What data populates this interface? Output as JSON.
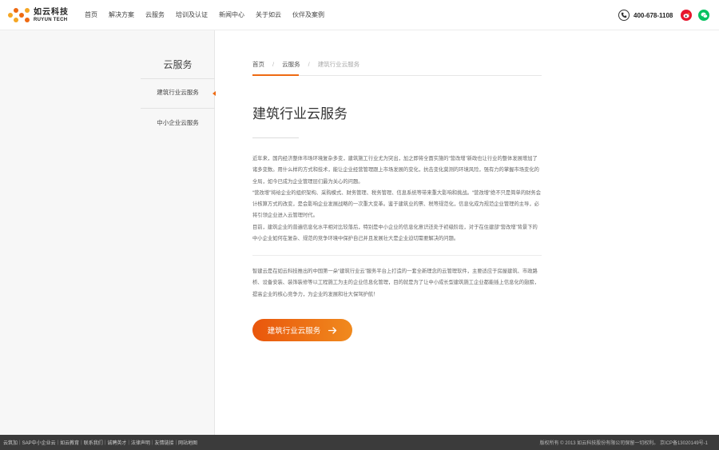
{
  "brand": {
    "name_cn": "如云科技",
    "name_en": "RUYUN TECH",
    "colors": {
      "accent": "#ee6a12",
      "accent_light": "#f5a623",
      "weibo": "#e6162d",
      "wechat": "#07c160"
    }
  },
  "nav": {
    "items": [
      "首页",
      "解决方案",
      "云服务",
      "培训及认证",
      "新闻中心",
      "关于如云",
      "伙伴及案例"
    ]
  },
  "contact": {
    "phone": "400-678-1108",
    "phone_icon": "phone-icon",
    "social_icons": [
      "weibo-icon",
      "wechat-icon"
    ]
  },
  "sidebar": {
    "title": "云服务",
    "items": [
      {
        "label": "建筑行业云服务",
        "active": true
      },
      {
        "label": "中小企业云服务",
        "active": false
      }
    ]
  },
  "breadcrumb": [
    "首页",
    "云服务",
    "建筑行业云服务"
  ],
  "breadcrumb_separator": "/",
  "content": {
    "title": "建筑行业云服务",
    "paragraphs_1": [
      "近年来，国内经济整体市场环境复杂多变，建筑施工行业尤为突出，加之即将全面实施的“营改增”新政也让行业的整体发展增加了诸多变数。用什么样的方式和技术，能让企业经营管理跟上市场发展的变化，抗击变化莫测的环境风险，强有力的掌握市场变化的全局，如今已成为企业管理层们最为关心的问题。",
      "“营改增”将给企业的组织架构、采购模式、财务管理、税务管理、信息系统等带来重大影响和挑战。“营改增”绝不只是简单的财务会计核算方式的改变，是会影响企业发展战略的一次重大变革。鉴于建筑业的票、税等规范化，信息化成为规范企业管理的主导，必将引领企业进入云管理时代。",
      "目前，建筑企业的普遍信息化水平相对比较落后，特别是中小企业的信息化意识还处于初级阶段，对于在住建部“营改增”背景下的中小企业如何在复杂、规范的竞争环境中保护自己并且发展壮大是企业迫切需要解决的问题。"
    ],
    "paragraphs_2": [
      "智建云是在如云科技推出的中国第一朵“建筑行业云”服务平台上打造的一套全新理念的云管理软件，主要适应于房屋建筑、市政路桥、设备安装、装饰装修等以工程施工为主的企业信息化管理，目的就是为了让中小成长型建筑施工企业都能插上信息化的翅膀，提高企业的核心竞争力，为企业的发展和壮大保驾护航！"
    ],
    "cta_label": "建筑行业云服务",
    "cta_icon": "arrow-right-icon"
  },
  "footer": {
    "links": [
      "云筑加",
      "SAP中小企业云",
      "如云教育",
      "联系我们",
      "诚聘英才",
      "法律声明",
      "友情链接",
      "网站地图"
    ],
    "copyright": "版权所有 © 2013 如云科技股份有限公司保留一切权利。 京ICP备13020149号-1"
  }
}
